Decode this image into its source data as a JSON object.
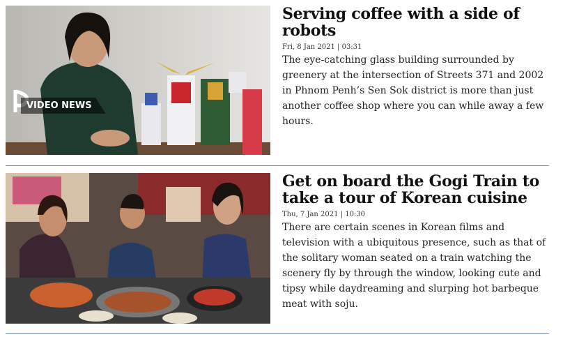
{
  "articles": [
    {
      "headline": "Serving coffee with a side of robots",
      "date": "Fri, 8 Jan 2021 | 03:31",
      "summary": "The eye-catching glass building surrounded by greenery at the intersection of Streets 371 and 2002 in Phnom Penh’s Sen Sok district is more than just another coffee shop where you can while away a few hours.",
      "badge": "VIDEO NEWS"
    },
    {
      "headline": "Get on board the Gogi Train to take a tour of Korean cuisine",
      "date": "Thu, 7 Jan 2021 | 10:30",
      "summary": "There are certain scenes in Korean films and television with a ubiquitous presence, such as that of the solitary woman seated on a train watching the scenery fly by through the window, looking cute and tipsy while daydreaming and slurping hot barbeque meat with soju."
    }
  ],
  "colors": {
    "divider": "#7a93b0"
  }
}
